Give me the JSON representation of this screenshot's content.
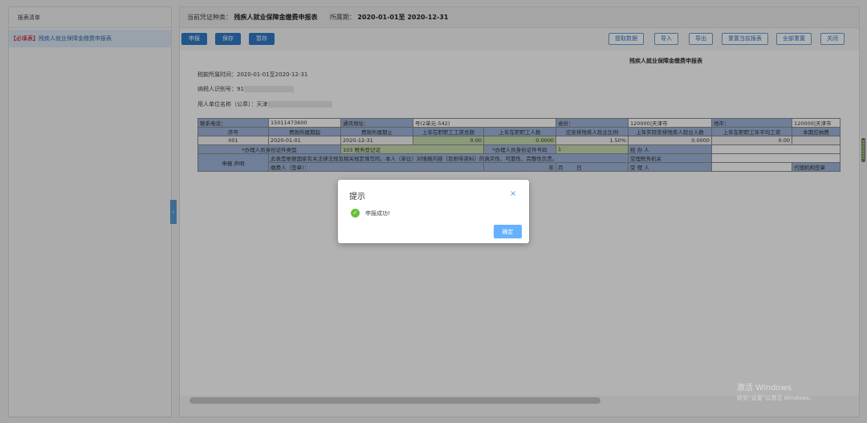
{
  "sidebar": {
    "title": "报表清单",
    "items": [
      {
        "tag": "【必填表】",
        "label": "残疾人就业保障金缴费申报表"
      }
    ]
  },
  "topbar": {
    "voucher_label": "当前凭证种类：",
    "voucher_value": "残疾人就业保障金缴费申报表",
    "period_label": "所属期：",
    "period_value": "2020-01-01至 2020-12-31"
  },
  "toolbar": {
    "left_buttons": [
      "申报",
      "保存",
      "暂存"
    ],
    "right_buttons": [
      "提取数据",
      "导入",
      "导出",
      "重置当前报表",
      "全部重置",
      "关闭"
    ]
  },
  "form": {
    "title": "残疾人就业保障金缴费申报表",
    "period_line": "税款所属时间：2020-01-01至2020-12-31",
    "taxpayer_id_label": "纳税人识别号：91",
    "employer_label": "用人单位名称（公章）：天津",
    "row1": {
      "phone_label": "联系电话：",
      "phone_value": "15011473600",
      "address_label": "通讯地址：",
      "address_value": "号(2单元-542)",
      "province_label": "省份：",
      "province_value": "120000|天津市",
      "city_label": "地市：",
      "city_value": "120000|天津市"
    },
    "headers": [
      "序号",
      "费款所属期起",
      "费款所属期止",
      "上年在职职工工资总额",
      "上年在职职工人数",
      "应安排残疾人就业比例",
      "上年实际安排残疾人就业人数",
      "上年在职职工年平均工资",
      "本期应纳费"
    ],
    "data_row": [
      "001",
      "2020-01-01",
      "2020-12-31",
      "0.00",
      "0.0000",
      "1.50%",
      "0.0000",
      "0.00",
      ""
    ],
    "agent_doc_type_label": "*办理人员身份证件类型",
    "agent_doc_type_value": "103 税务登记证",
    "agent_doc_no_label": "*办理人员身份证件号码",
    "agent_doc_no_value": "1",
    "handler_label": "经 办 人",
    "declaration_label": "申报 声明",
    "declaration_text": "此表是根据国家有关法律法规及相关规定填写的。本人（单位）对填报内容（及附带资料）的真实性、可靠性、完整性负责。",
    "tax_authority_label": "受理税务机关",
    "signer_label": "缴费人（签章）：",
    "year_label": "年",
    "month_label": "月",
    "day_label": "日",
    "acceptor_label": "受 理 人",
    "agent_seal_label": "代理机构签章"
  },
  "dialog": {
    "title": "提示",
    "message": "申报成功!",
    "ok_label": "确定",
    "close_glyph": "×",
    "icon": "check-circle-icon"
  },
  "watermark": {
    "line1": "激活 Windows",
    "line2": "转到“设置”以激活 Windows。"
  },
  "colors": {
    "primary": "#2f7cc9",
    "table_header": "#9fb7dc",
    "green_cell": "#c8dcb0",
    "success": "#67c23a",
    "ok_button": "#66b1ff"
  }
}
